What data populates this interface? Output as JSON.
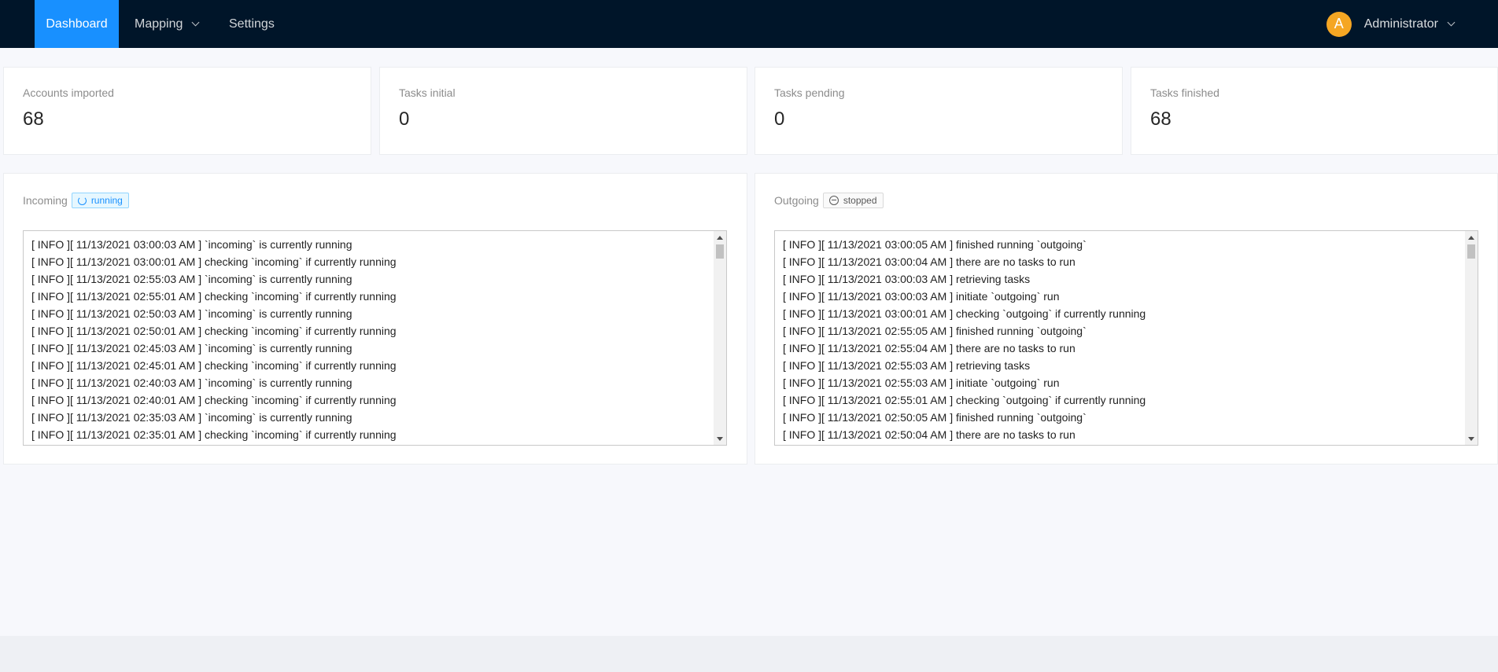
{
  "nav": {
    "items": [
      {
        "label": "Dashboard",
        "active": true
      },
      {
        "label": "Mapping",
        "active": false,
        "has_dropdown": true
      },
      {
        "label": "Settings",
        "active": false
      }
    ],
    "user": {
      "avatar_initial": "A",
      "name": "Administrator"
    }
  },
  "stats": [
    {
      "label": "Accounts imported",
      "value": "68"
    },
    {
      "label": "Tasks initial",
      "value": "0"
    },
    {
      "label": "Tasks pending",
      "value": "0"
    },
    {
      "label": "Tasks finished",
      "value": "68"
    }
  ],
  "incoming": {
    "title": "Incoming",
    "status": "running",
    "logs": [
      "[ INFO ][ 11/13/2021 03:00:03 AM ] `incoming` is currently running",
      "[ INFO ][ 11/13/2021 03:00:01 AM ] checking `incoming` if currently running",
      "[ INFO ][ 11/13/2021 02:55:03 AM ] `incoming` is currently running",
      "[ INFO ][ 11/13/2021 02:55:01 AM ] checking `incoming` if currently running",
      "[ INFO ][ 11/13/2021 02:50:03 AM ] `incoming` is currently running",
      "[ INFO ][ 11/13/2021 02:50:01 AM ] checking `incoming` if currently running",
      "[ INFO ][ 11/13/2021 02:45:03 AM ] `incoming` is currently running",
      "[ INFO ][ 11/13/2021 02:45:01 AM ] checking `incoming` if currently running",
      "[ INFO ][ 11/13/2021 02:40:03 AM ] `incoming` is currently running",
      "[ INFO ][ 11/13/2021 02:40:01 AM ] checking `incoming` if currently running",
      "[ INFO ][ 11/13/2021 02:35:03 AM ] `incoming` is currently running",
      "[ INFO ][ 11/13/2021 02:35:01 AM ] checking `incoming` if currently running"
    ]
  },
  "outgoing": {
    "title": "Outgoing",
    "status": "stopped",
    "logs": [
      "[ INFO ][ 11/13/2021 03:00:05 AM ] finished running `outgoing`",
      "[ INFO ][ 11/13/2021 03:00:04 AM ] there are no tasks to run",
      "[ INFO ][ 11/13/2021 03:00:03 AM ] retrieving tasks",
      "[ INFO ][ 11/13/2021 03:00:03 AM ] initiate `outgoing` run",
      "[ INFO ][ 11/13/2021 03:00:01 AM ] checking `outgoing` if currently running",
      "[ INFO ][ 11/13/2021 02:55:05 AM ] finished running `outgoing`",
      "[ INFO ][ 11/13/2021 02:55:04 AM ] there are no tasks to run",
      "[ INFO ][ 11/13/2021 02:55:03 AM ] retrieving tasks",
      "[ INFO ][ 11/13/2021 02:55:03 AM ] initiate `outgoing` run",
      "[ INFO ][ 11/13/2021 02:55:01 AM ] checking `outgoing` if currently running",
      "[ INFO ][ 11/13/2021 02:50:05 AM ] finished running `outgoing`",
      "[ INFO ][ 11/13/2021 02:50:04 AM ] there are no tasks to run"
    ]
  },
  "colors": {
    "nav_bg": "#001529",
    "active_tab": "#1890ff",
    "avatar": "#f5a623",
    "running_tag": "#1890ff"
  },
  "icons": {
    "running": "loading-spinner-icon",
    "stopped": "minus-circle-icon",
    "dropdown": "chevron-down-icon"
  }
}
